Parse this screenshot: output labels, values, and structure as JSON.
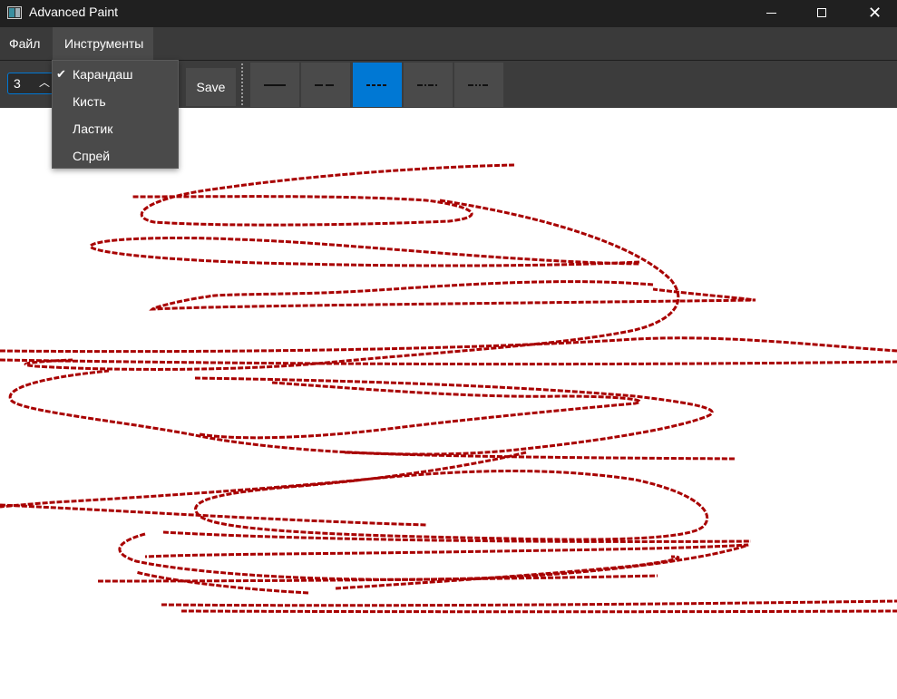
{
  "window": {
    "title": "Advanced Paint",
    "controls": {
      "minimize": "─",
      "maximize": "□",
      "close": "✕"
    }
  },
  "menubar": {
    "items": [
      {
        "label": "Файл"
      },
      {
        "label": "Инструменты"
      }
    ]
  },
  "toolbar": {
    "size_value": "3",
    "spin_up_glyph": "︿",
    "save_label": "Save",
    "line_styles": [
      {
        "name": "solid"
      },
      {
        "name": "dash"
      },
      {
        "name": "dash-dense",
        "active": true
      },
      {
        "name": "dash-dot"
      },
      {
        "name": "dash-dot-dot"
      }
    ]
  },
  "tools_menu": {
    "items": [
      {
        "label": "Карандаш",
        "checked": true
      },
      {
        "label": "Кисть",
        "checked": false
      },
      {
        "label": "Ластик",
        "checked": false
      },
      {
        "label": "Спрей",
        "checked": false
      }
    ],
    "check_glyph": "✔"
  },
  "colors": {
    "stroke": "#a80000",
    "accent": "#0078d4",
    "titlebar": "#202020",
    "toolbar": "#3c3c3c"
  }
}
